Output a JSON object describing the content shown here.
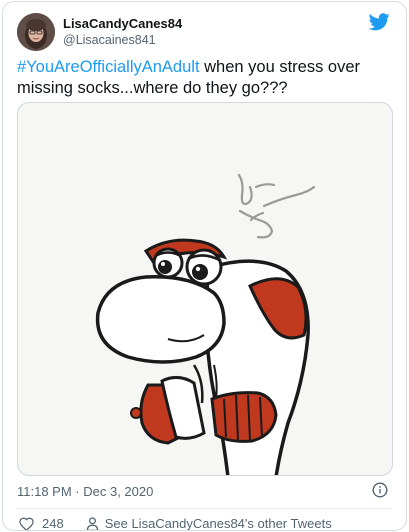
{
  "author": {
    "display_name": "LisaCandyCanes84",
    "handle": "@Lisacaines841"
  },
  "tweet": {
    "hashtag": "#YouAreOfficiallyAnAdult",
    "text": " when you stress over missing socks...where do they go???"
  },
  "meta": {
    "timestamp": "11:18 PM · Dec 3, 2020"
  },
  "actions": {
    "like_count": "248",
    "profile_link": "See LisaCandyCanes84's other Tweets"
  },
  "colors": {
    "accent": "#1d9bf0",
    "sock_red": "#c0391f"
  },
  "icons": {
    "brand": "twitter-bird-icon",
    "info": "info-icon",
    "like": "heart-icon",
    "profile": "person-icon"
  }
}
